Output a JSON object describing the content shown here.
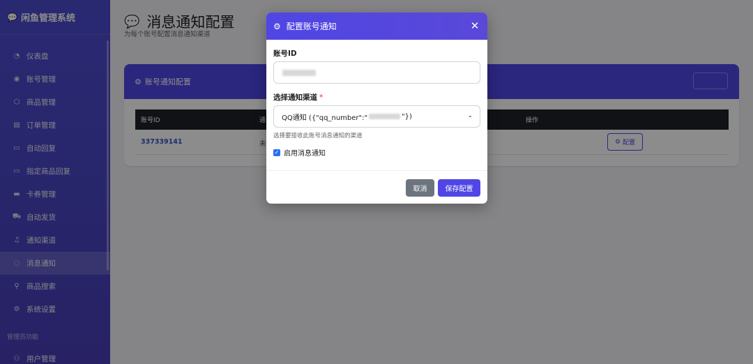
{
  "sidebar": {
    "brand": "闲鱼管理系统",
    "brand_icon": "chat-bubble-icon",
    "items": [
      {
        "label": "仪表盘",
        "icon": "dashboard-icon"
      },
      {
        "label": "账号管理",
        "icon": "user-circle-icon"
      },
      {
        "label": "商品管理",
        "icon": "box-icon"
      },
      {
        "label": "订单管理",
        "icon": "list-icon"
      },
      {
        "label": "自动回复",
        "icon": "chat-icon"
      },
      {
        "label": "指定商品回复",
        "icon": "chat-icon"
      },
      {
        "label": "卡券管理",
        "icon": "card-icon"
      },
      {
        "label": "自动发货",
        "icon": "truck-icon"
      },
      {
        "label": "通知渠道",
        "icon": "bell-icon"
      },
      {
        "label": "消息通知",
        "icon": "message-icon",
        "active": true
      },
      {
        "label": "商品搜索",
        "icon": "search-icon"
      },
      {
        "label": "系统设置",
        "icon": "gear-icon"
      }
    ],
    "admin_section": "管理员功能",
    "admin_items": [
      {
        "label": "用户管理",
        "icon": "users-icon"
      }
    ]
  },
  "page": {
    "title": "消息通知配置",
    "subtitle": "为每个账号配置消息通知渠道"
  },
  "card": {
    "title": "账号通知配置",
    "columns": [
      "账号ID",
      "通",
      "操作"
    ],
    "rows": [
      {
        "account_id": "337339141",
        "status": "未",
        "action": "配置"
      }
    ]
  },
  "modal": {
    "title": "配置账号通知",
    "account_label": "账号ID",
    "channel_label": "选择通知渠道",
    "required_mark": "*",
    "channel_value_prefix": "QQ通知 ({\"qq_number\":\"",
    "channel_value_suffix": "\"})",
    "hint": "选择要接收此账号消息通知的渠道",
    "enable_label": "启用消息通知",
    "enable_checked": true,
    "cancel_label": "取消",
    "save_label": "保存配置"
  },
  "colors": {
    "primary": "#4f46e5",
    "sidebar": "#4b4bd0",
    "cancel": "#6c757d",
    "link": "#2f55c9"
  }
}
